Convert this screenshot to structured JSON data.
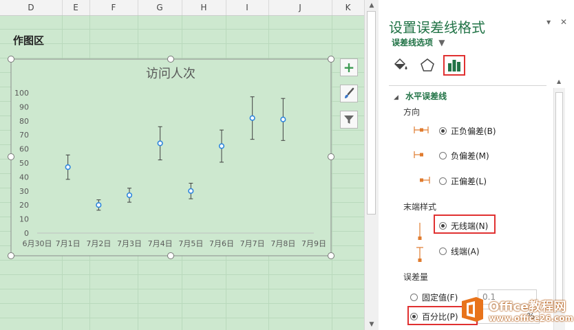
{
  "spreadsheet": {
    "columns": [
      "D",
      "E",
      "F",
      "G",
      "H",
      "I",
      "J",
      "K"
    ],
    "plot_area_label": "作图区"
  },
  "chart_data": {
    "type": "scatter",
    "title": "访问人次",
    "categories": [
      "6月30日",
      "7月1日",
      "7月2日",
      "7月3日",
      "7月4日",
      "7月5日",
      "7月6日",
      "7月7日",
      "7月8日",
      "7月9日"
    ],
    "yticks": [
      0,
      10,
      20,
      30,
      40,
      50,
      60,
      70,
      80,
      90,
      100
    ],
    "ylim": [
      0,
      100
    ],
    "series": [
      {
        "x": [
          "7月1日",
          "7月2日",
          "7月3日",
          "7月4日",
          "7月5日",
          "7月6日",
          "7月7日",
          "7月8日"
        ],
        "values": [
          47,
          20,
          27,
          64,
          30,
          62,
          82,
          81
        ]
      }
    ],
    "error_bars": {
      "type": "percentage",
      "percent": 18.5,
      "end_style": "no_cap",
      "direction": "both"
    },
    "colors": {
      "marker": "#2e86de",
      "error_bar": "#404040",
      "plot_bg": "#cde8cf"
    },
    "grid": false
  },
  "chart_tools": {
    "elements_icon": "plus-icon",
    "styles_icon": "brush-icon",
    "filters_icon": "filter-icon"
  },
  "pane": {
    "title": "设置误差线格式",
    "subtitle": "误差线选项",
    "controls": {
      "dropdown": "▾",
      "close": "✕"
    },
    "tabs": [
      "fill-line-icon",
      "effects-icon",
      "error-bar-options-icon"
    ],
    "section_title": "水平误差线",
    "direction": {
      "label": "方向",
      "options": [
        "正负偏差(B)",
        "负偏差(M)",
        "正偏差(L)"
      ],
      "selected": 0
    },
    "end_style": {
      "label": "末端样式",
      "options": [
        "无线端(N)",
        "线端(A)"
      ],
      "selected": 0
    },
    "amount": {
      "label": "误差量",
      "fixed_label": "固定值(F)",
      "fixed_value": "0.1",
      "percent_label": "百分比(P)",
      "percent_suffix": "%"
    },
    "accent_color": "#217346",
    "highlight_color": "#e03030"
  },
  "watermark": {
    "brand": "Office教程网",
    "url": "www.office26.com"
  }
}
